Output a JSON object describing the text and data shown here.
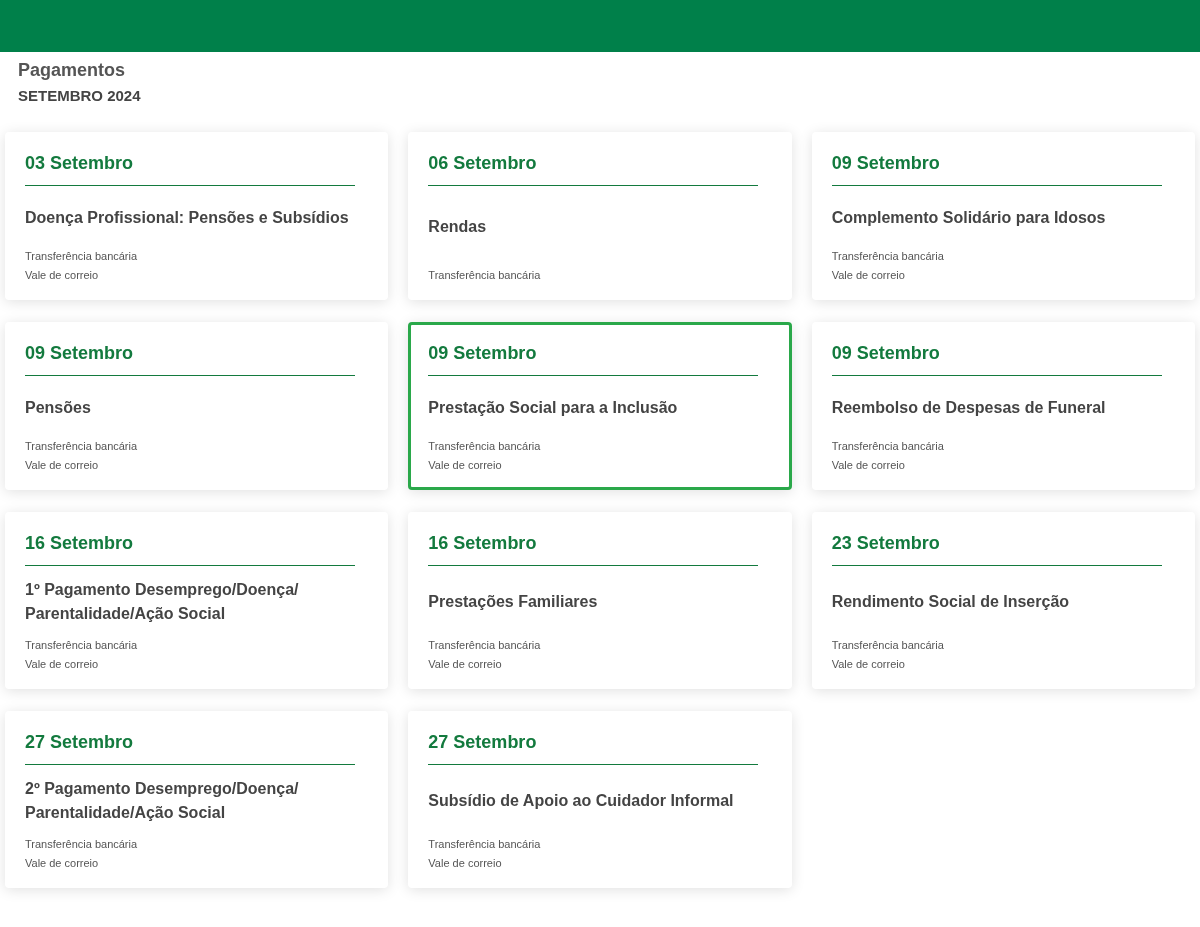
{
  "page": {
    "title": "Pagamentos",
    "subtitle": "SETEMBRO 2024"
  },
  "cards": [
    {
      "date": "03 Setembro",
      "title": "Doença Profissional: Pensões e Subsídios",
      "methods": [
        "Transferência bancária",
        "Vale de correio"
      ],
      "selected": false
    },
    {
      "date": "06 Setembro",
      "title": "Rendas",
      "methods": [
        "Transferência bancária"
      ],
      "selected": false
    },
    {
      "date": "09 Setembro",
      "title": "Complemento Solidário para Idosos",
      "methods": [
        "Transferência bancária",
        "Vale de correio"
      ],
      "selected": false
    },
    {
      "date": "09 Setembro",
      "title": "Pensões",
      "methods": [
        "Transferência bancária",
        "Vale de correio"
      ],
      "selected": false
    },
    {
      "date": "09 Setembro",
      "title": "Prestação Social para a Inclusão",
      "methods": [
        "Transferência bancária",
        "Vale de correio"
      ],
      "selected": true
    },
    {
      "date": "09 Setembro",
      "title": "Reembolso de Despesas de Funeral",
      "methods": [
        "Transferência bancária",
        "Vale de correio"
      ],
      "selected": false
    },
    {
      "date": "16 Setembro",
      "title": "1º Pagamento Desemprego/Doença/ Parentalidade/Ação Social",
      "methods": [
        "Transferência bancária",
        "Vale de correio"
      ],
      "selected": false
    },
    {
      "date": "16 Setembro",
      "title": "Prestações Familiares",
      "methods": [
        "Transferência bancária",
        "Vale de correio"
      ],
      "selected": false
    },
    {
      "date": "23 Setembro",
      "title": "Rendimento Social de Inserção",
      "methods": [
        "Transferência bancária",
        "Vale de correio"
      ],
      "selected": false
    },
    {
      "date": "27 Setembro",
      "title": "2º Pagamento Desemprego/Doença/ Parentalidade/Ação Social",
      "methods": [
        "Transferência bancária",
        "Vale de correio"
      ],
      "selected": false
    },
    {
      "date": "27 Setembro",
      "title": "Subsídio de Apoio ao Cuidador Informal",
      "methods": [
        "Transferência bancária",
        "Vale de correio"
      ],
      "selected": false
    }
  ]
}
